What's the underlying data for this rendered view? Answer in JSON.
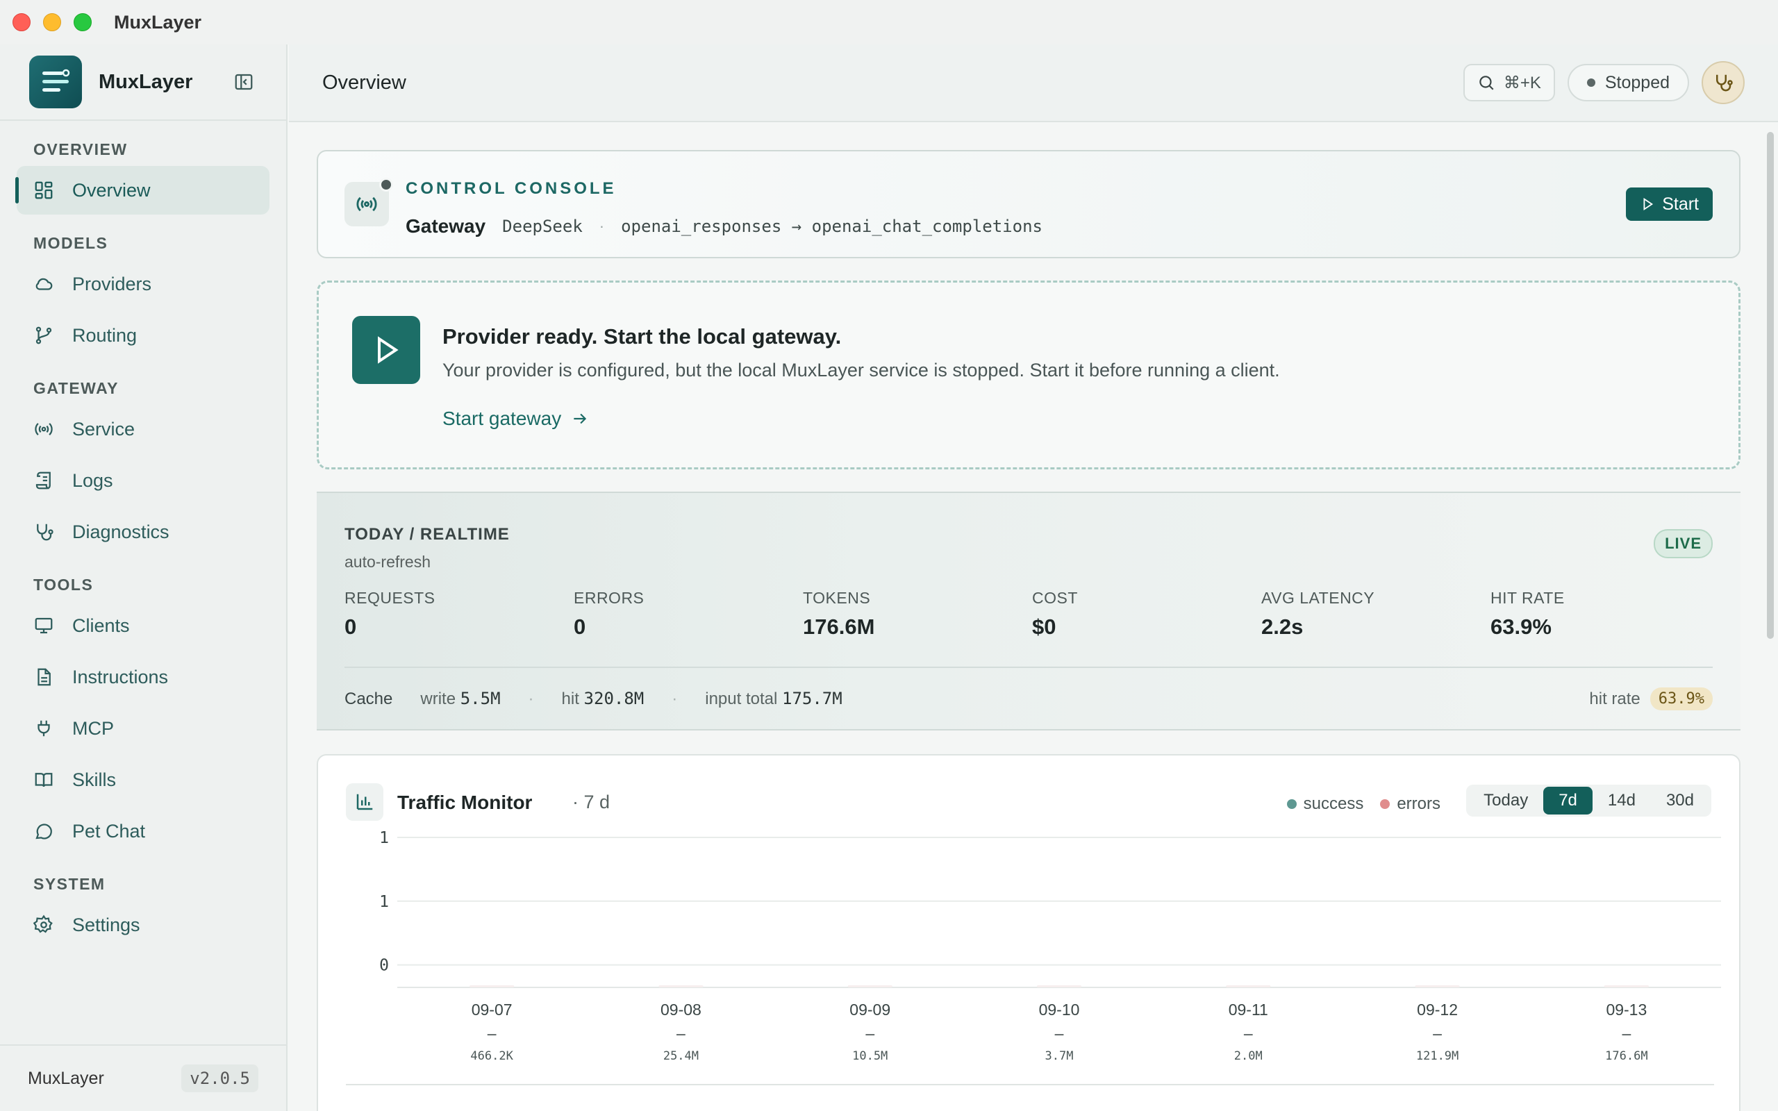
{
  "window": {
    "title": "MuxLayer"
  },
  "sidebar": {
    "brand": "MuxLayer",
    "sections": [
      {
        "title": "OVERVIEW",
        "items": [
          {
            "label": "Overview",
            "icon": "grid-icon",
            "active": true
          }
        ]
      },
      {
        "title": "MODELS",
        "items": [
          {
            "label": "Providers",
            "icon": "cloud-icon"
          },
          {
            "label": "Routing",
            "icon": "git-branch-icon"
          }
        ]
      },
      {
        "title": "GATEWAY",
        "items": [
          {
            "label": "Service",
            "icon": "broadcast-icon"
          },
          {
            "label": "Logs",
            "icon": "scroll-icon"
          },
          {
            "label": "Diagnostics",
            "icon": "stethoscope-icon"
          }
        ]
      },
      {
        "title": "TOOLS",
        "items": [
          {
            "label": "Clients",
            "icon": "monitor-icon"
          },
          {
            "label": "Instructions",
            "icon": "document-icon"
          },
          {
            "label": "MCP",
            "icon": "plug-icon"
          },
          {
            "label": "Skills",
            "icon": "book-icon"
          },
          {
            "label": "Pet Chat",
            "icon": "chat-bubble-icon"
          }
        ]
      },
      {
        "title": "SYSTEM",
        "items": [
          {
            "label": "Settings",
            "icon": "gear-icon"
          }
        ]
      }
    ],
    "footer": {
      "name": "MuxLayer",
      "version": "v2.0.5"
    }
  },
  "header": {
    "title": "Overview",
    "search_shortcut": "⌘+K",
    "status": "Stopped"
  },
  "console": {
    "label": "CONTROL CONSOLE",
    "gateway_label": "Gateway",
    "provider": "DeepSeek",
    "separator": "·",
    "route": "openai_responses → openai_chat_completions",
    "start_label": "Start"
  },
  "ready": {
    "title": "Provider ready. Start the local gateway.",
    "description": "Your provider is configured, but the local MuxLayer service is stopped. Start it before running a client.",
    "link": "Start gateway"
  },
  "stats": {
    "heading": "TODAY / REALTIME",
    "subheading": "auto-refresh",
    "live": "LIVE",
    "metrics": [
      {
        "label": "REQUESTS",
        "value": "0"
      },
      {
        "label": "ERRORS",
        "value": "0"
      },
      {
        "label": "TOKENS",
        "value": "176.6M"
      },
      {
        "label": "COST",
        "value": "$0"
      },
      {
        "label": "AVG LATENCY",
        "value": "2.2s"
      },
      {
        "label": "HIT RATE",
        "value": "63.9%"
      }
    ],
    "cache": {
      "label": "Cache",
      "write_label": "write",
      "write_value": "5.5M",
      "hit_label": "hit",
      "hit_value": "320.8M",
      "input_label": "input total",
      "input_value": "175.7M",
      "sep": "·",
      "hit_rate_label": "hit rate",
      "hit_rate_value": "63.9%"
    }
  },
  "traffic": {
    "title": "Traffic Monitor",
    "range": "· 7 d",
    "legend": {
      "success": "success",
      "errors": "errors"
    },
    "ranges": [
      {
        "label": "Today"
      },
      {
        "label": "7d",
        "active": true
      },
      {
        "label": "14d"
      },
      {
        "label": "30d"
      }
    ],
    "colors": {
      "success": "#5e9892",
      "errors": "#e08c8c",
      "accent": "#135f5a"
    }
  },
  "chart_data": {
    "type": "bar",
    "title": "",
    "categories": [
      "09-07",
      "09-08",
      "09-09",
      "09-10",
      "09-11",
      "09-12",
      "09-13"
    ],
    "y_tick_labels": [
      "1",
      "1",
      "0"
    ],
    "ylim": [
      0,
      1
    ],
    "value_labels": [
      "–",
      "–",
      "–",
      "–",
      "–",
      "–",
      "–"
    ],
    "token_labels": [
      "466.2K",
      "25.4M",
      "10.5M",
      "3.7M",
      "2.0M",
      "121.9M",
      "176.6M"
    ],
    "series": [
      {
        "name": "success",
        "values": [
          0,
          0,
          0,
          0,
          0,
          0,
          0
        ]
      },
      {
        "name": "errors",
        "values": [
          0,
          0,
          0,
          0,
          0,
          0,
          0
        ]
      }
    ],
    "grid": true
  }
}
